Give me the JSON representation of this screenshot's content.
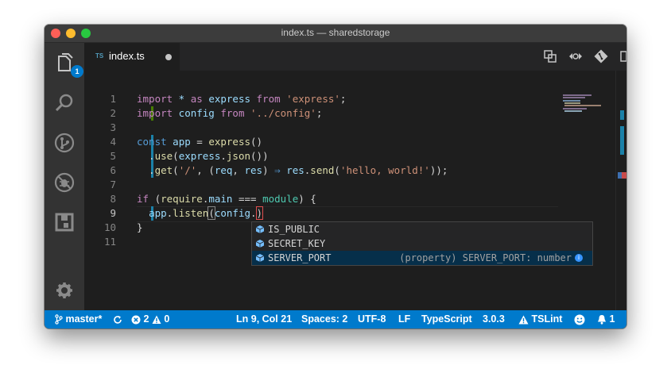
{
  "window": {
    "title": "index.ts — sharedstorage"
  },
  "activity": {
    "explorer_badge": "1"
  },
  "tab": {
    "lang": "TS",
    "name": "index.ts"
  },
  "editor": {
    "line_numbers": [
      "1",
      "2",
      "3",
      "4",
      "5",
      "6",
      "7",
      "8",
      "9",
      "10",
      "11"
    ],
    "tokens": {
      "l1": [
        "import",
        " * ",
        "as",
        " express ",
        "from",
        " ",
        "'express'",
        ";"
      ],
      "l2": [
        "import",
        " config ",
        "from",
        " ",
        "'../config'",
        ";"
      ],
      "l4": [
        "const",
        " ",
        "app",
        " = ",
        "express",
        "()"
      ],
      "l5": [
        "  .",
        "use",
        "(",
        "express",
        ".",
        "json",
        "())"
      ],
      "l6": [
        "  .",
        "get",
        "(",
        "'/'",
        ", (",
        "req",
        ", ",
        "res",
        ") ",
        "⇒",
        " ",
        "res",
        ".",
        "send",
        "(",
        "'hello, world!'",
        "));"
      ],
      "l8": [
        "if",
        " (",
        "require",
        ".",
        "main",
        " ",
        "===",
        " ",
        "module",
        ") {"
      ],
      "l9": [
        "  ",
        "app",
        ".",
        "listen",
        "(",
        "config",
        ".",
        ")"
      ],
      "l10": [
        "}"
      ]
    }
  },
  "suggest": {
    "items": [
      {
        "label": "IS_PUBLIC",
        "detail": ""
      },
      {
        "label": "SECRET_KEY",
        "detail": ""
      },
      {
        "label": "SERVER_PORT",
        "detail": "(property) SERVER_PORT: number"
      }
    ],
    "info_glyph": "i"
  },
  "status": {
    "branch": "master*",
    "errors": "2",
    "warnings": "0",
    "position": "Ln 9, Col 21",
    "spaces": "Spaces: 2",
    "encoding": "UTF-8",
    "eol": "LF",
    "language": "TypeScript",
    "version": "3.0.3",
    "linter": "TSLint",
    "notifications": "1"
  },
  "colors": {
    "accent": "#007acc",
    "modified_gutter": "#1b81a8",
    "added_gutter": "#487e02"
  }
}
